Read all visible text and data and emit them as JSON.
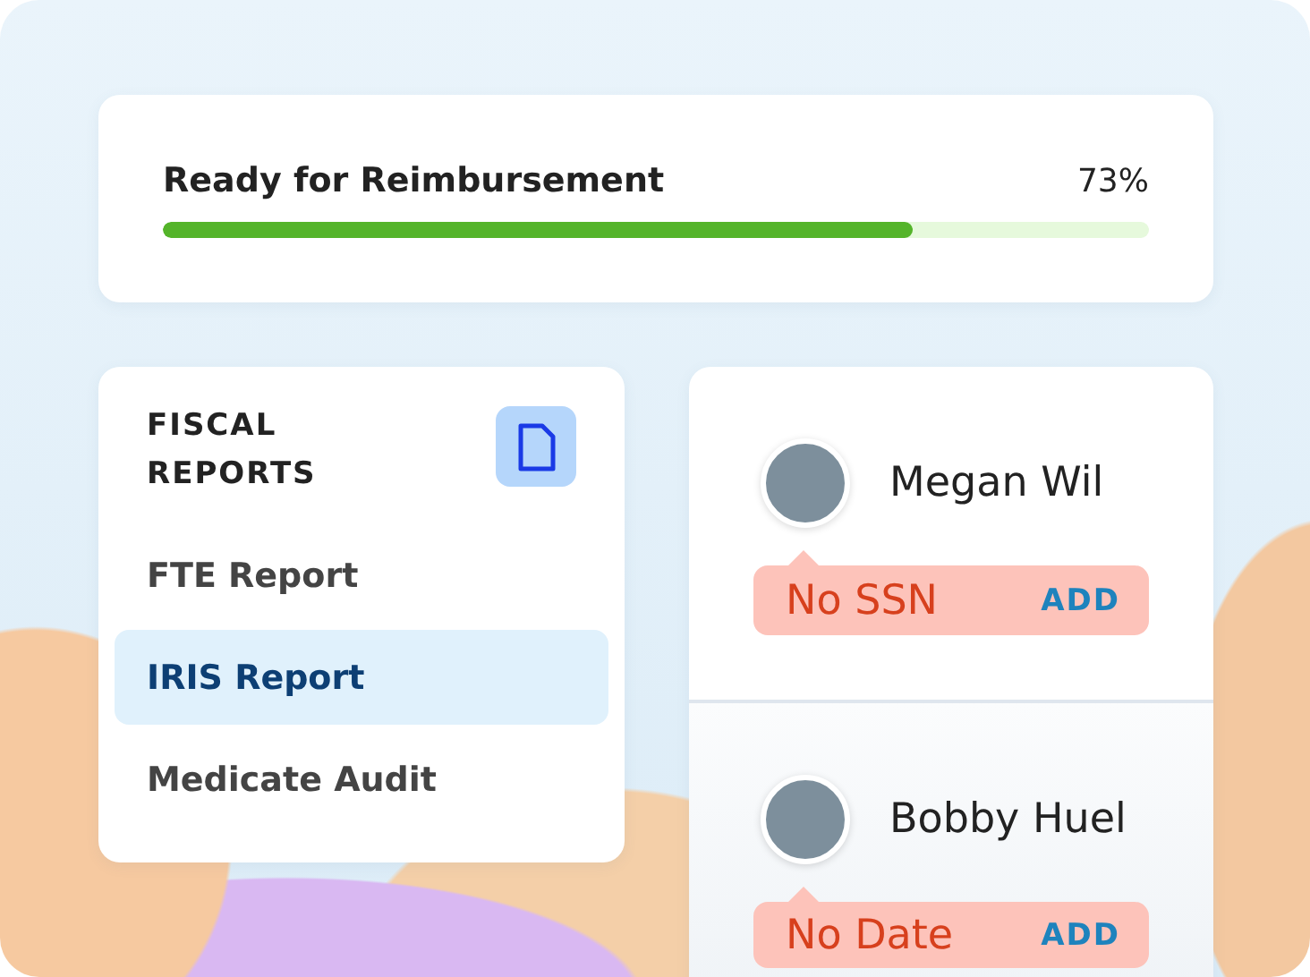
{
  "progress": {
    "label": "Ready for Reimbursement",
    "reading": "73%",
    "level": 0.76
  },
  "reports": {
    "title": "FISCAL REPORTS",
    "items": [
      {
        "label": "FTE Report",
        "selected": false
      },
      {
        "label": "IRIS Report",
        "selected": true
      },
      {
        "label": "Medicate Audit",
        "selected": false
      }
    ]
  },
  "people": [
    {
      "name": "Megan Wil",
      "issue": "No SSN",
      "action": "ADD"
    },
    {
      "name": "Bobby Huel",
      "issue": "No Date",
      "action": "ADD"
    }
  ]
}
